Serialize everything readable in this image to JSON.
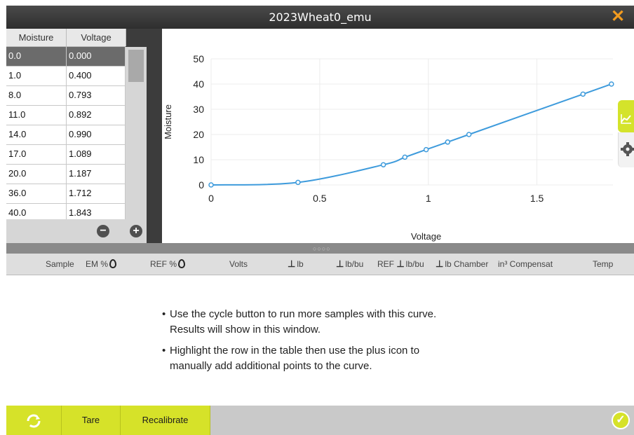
{
  "window": {
    "title": "2023Wheat0_emu"
  },
  "table": {
    "headers": {
      "moisture": "Moisture",
      "voltage": "Voltage"
    },
    "rows": [
      {
        "moisture": "0.0",
        "voltage": "0.000"
      },
      {
        "moisture": "1.0",
        "voltage": "0.400"
      },
      {
        "moisture": "8.0",
        "voltage": "0.793"
      },
      {
        "moisture": "11.0",
        "voltage": "0.892"
      },
      {
        "moisture": "14.0",
        "voltage": "0.990"
      },
      {
        "moisture": "17.0",
        "voltage": "1.089"
      },
      {
        "moisture": "20.0",
        "voltage": "1.187"
      },
      {
        "moisture": "36.0",
        "voltage": "1.712"
      },
      {
        "moisture": "40.0",
        "voltage": "1.843"
      }
    ],
    "selected_row": 0,
    "remove_icon": "minus-circle-icon",
    "add_icon": "plus-circle-icon"
  },
  "chart_data": {
    "type": "line",
    "xlabel": "Voltage",
    "ylabel": "Moisture",
    "xlim": [
      0,
      1.85
    ],
    "ylim": [
      0,
      50
    ],
    "x_ticks": [
      "0",
      "0.5",
      "1",
      "1.5"
    ],
    "y_ticks": [
      "0",
      "10",
      "20",
      "30",
      "40",
      "50"
    ],
    "series": [
      {
        "x": [
          0,
          0.4,
          0.793,
          0.892,
          0.99,
          1.089,
          1.187,
          1.712,
          1.843
        ],
        "y": [
          0,
          1,
          8,
          11,
          14,
          17,
          20,
          36,
          40
        ],
        "color": "#3e9bdc"
      }
    ],
    "grid": true
  },
  "side_tabs": {
    "chart_icon": "chart-icon",
    "settings_icon": "gear-icon"
  },
  "results_header": {
    "sample": "Sample",
    "em": "EM %",
    "ref": "REF %",
    "volts": "Volts",
    "lb": "lb",
    "lbbu": "lb/bu",
    "ref_lbbu_prefix": "REF",
    "ref_lbbu": "lb/bu",
    "lb_chamber": "lb Chamber",
    "compensat": "in³ Compensat",
    "temp": "Temp"
  },
  "messages": {
    "line1a": "Use the cycle button to run more samples with this curve.",
    "line1b": "Results will show in this window.",
    "line2a": "Highlight the row in the table then use the plus icon to",
    "line2b": "manually add additional points to the curve."
  },
  "toolbar": {
    "cycle_icon": "cycle-icon",
    "tare": "Tare",
    "recalibrate": "Recalibrate",
    "accept_icon": "check-circle-icon"
  },
  "colors": {
    "accent": "#d6e229",
    "close": "#f29b1f",
    "line": "#3e9bdc"
  }
}
